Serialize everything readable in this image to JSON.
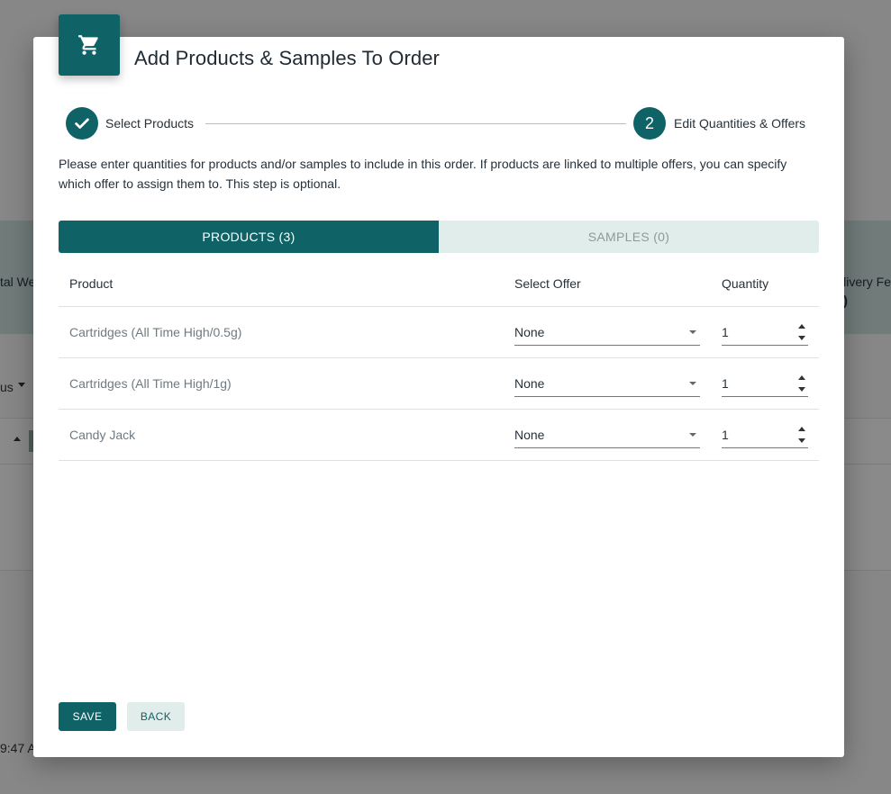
{
  "background": {
    "left_label": "tal We",
    "right_label": "livery Fe",
    "right_value": ")",
    "left_menu": "us",
    "time_fragment": "9:47 A"
  },
  "modal": {
    "title": "Add Products & Samples To Order",
    "icon": "shopping-cart-icon"
  },
  "stepper": {
    "step1": {
      "label": "Select Products",
      "state": "completed"
    },
    "step2": {
      "number": "2",
      "label": "Edit Quantities & Offers",
      "state": "active"
    }
  },
  "instructions": "Please enter quantities for products and/or samples to include in this order. If products are linked to multiple offers, you can specify which offer to assign them to. This step is optional.",
  "tabs": [
    {
      "label": "PRODUCTS (3)",
      "active": true
    },
    {
      "label": "SAMPLES (0)",
      "active": false
    }
  ],
  "table": {
    "headers": {
      "product": "Product",
      "offer": "Select Offer",
      "quantity": "Quantity"
    },
    "rows": [
      {
        "product": "Cartridges (All Time High/0.5g)",
        "offer": "None",
        "quantity": "1"
      },
      {
        "product": "Cartridges (All Time High/1g)",
        "offer": "None",
        "quantity": "1"
      },
      {
        "product": "Candy Jack",
        "offer": "None",
        "quantity": "1"
      }
    ]
  },
  "buttons": {
    "save": "SAVE",
    "back": "BACK"
  },
  "colors": {
    "primary": "#0f6265",
    "tab_inactive": "#e1edeb"
  }
}
